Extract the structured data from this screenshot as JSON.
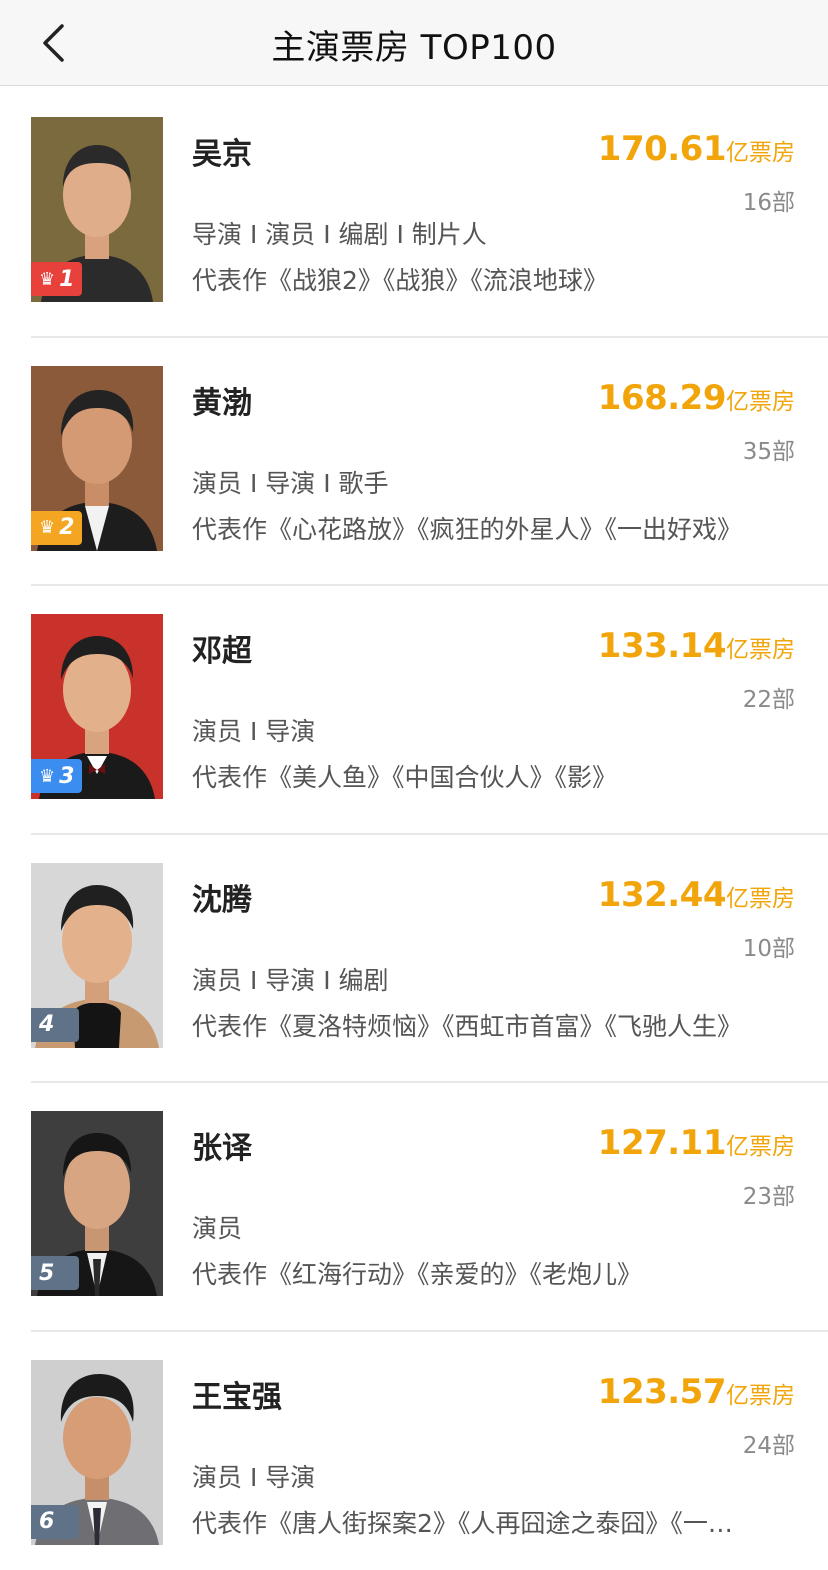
{
  "nav": {
    "title": "主演票房 TOP100",
    "back_icon": "chevron-left-icon"
  },
  "colors": {
    "accent": "#f2a50a",
    "rank1": "#e8413c",
    "rank2": "#f4a623",
    "rank3": "#3c8df0",
    "rank_other": "#5f7287"
  },
  "items": [
    {
      "rank": "1",
      "crown": "♛",
      "name": "吴京",
      "amount": "170.61",
      "unit": "亿票房",
      "count": "16部",
      "roles": "导演 I 演员 I 编剧 I 制片人",
      "works": "代表作《战狼2》《战狼》《流浪地球》",
      "photo_bg": "#7b6a3e"
    },
    {
      "rank": "2",
      "crown": "♛",
      "name": "黄渤",
      "amount": "168.29",
      "unit": "亿票房",
      "count": "35部",
      "roles": "演员 I 导演 I 歌手",
      "works": "代表作《心花路放》《疯狂的外星人》《一出好戏》",
      "photo_bg": "#8a5a3a"
    },
    {
      "rank": "3",
      "crown": "♛",
      "name": "邓超",
      "amount": "133.14",
      "unit": "亿票房",
      "count": "22部",
      "roles": "演员 I 导演",
      "works": "代表作《美人鱼》《中国合伙人》《影》",
      "photo_bg": "#c8322a"
    },
    {
      "rank": "4",
      "crown": "",
      "name": "沈腾",
      "amount": "132.44",
      "unit": "亿票房",
      "count": "10部",
      "roles": "演员 I 导演 I 编剧",
      "works": "代表作《夏洛特烦恼》《西虹市首富》《飞驰人生》",
      "photo_bg": "#d7d7d7"
    },
    {
      "rank": "5",
      "crown": "",
      "name": "张译",
      "amount": "127.11",
      "unit": "亿票房",
      "count": "23部",
      "roles": "演员",
      "works": "代表作《红海行动》《亲爱的》《老炮儿》",
      "photo_bg": "#3e3e3e"
    },
    {
      "rank": "6",
      "crown": "",
      "name": "王宝强",
      "amount": "123.57",
      "unit": "亿票房",
      "count": "24部",
      "roles": "演员 I 导演",
      "works": "代表作《唐人街探案2》《人再囧途之泰囧》《一…",
      "photo_bg": "#cfcfcf"
    }
  ]
}
